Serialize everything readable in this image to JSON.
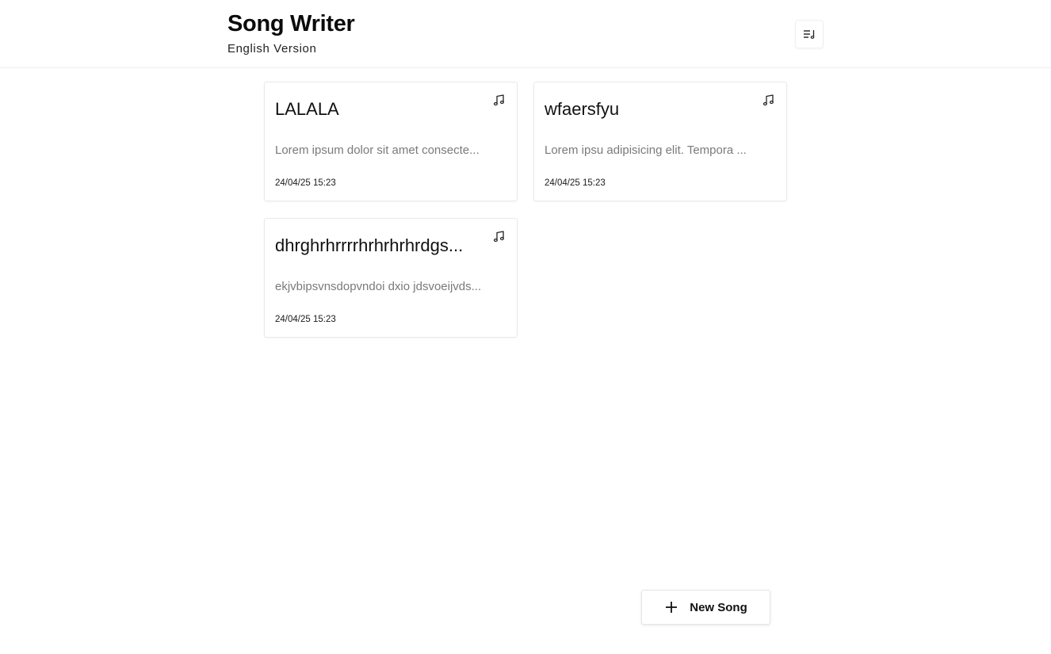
{
  "header": {
    "title": "Song Writer",
    "subtitle": "English Version",
    "menu_icon": "playlist-icon"
  },
  "songs": [
    {
      "title": "LALALA",
      "excerpt": "Lorem ipsum dolor sit amet consecte...",
      "date": "24/04/25 15:23",
      "icon": "music-note-icon"
    },
    {
      "title": "wfaersfyu",
      "excerpt": "Lorem ipsu adipisicing elit. Tempora ...",
      "date": "24/04/25 15:23",
      "icon": "music-note-icon"
    },
    {
      "title": "dhrghrhrrrrhrhrhrhrdgs...",
      "excerpt": "ekjvbipsvnsdopvndoi dxio jdsvoeijvds...",
      "date": "24/04/25 15:23",
      "icon": "music-note-icon"
    }
  ],
  "actions": {
    "new_song_label": "New Song",
    "new_song_icon": "plus-icon"
  }
}
